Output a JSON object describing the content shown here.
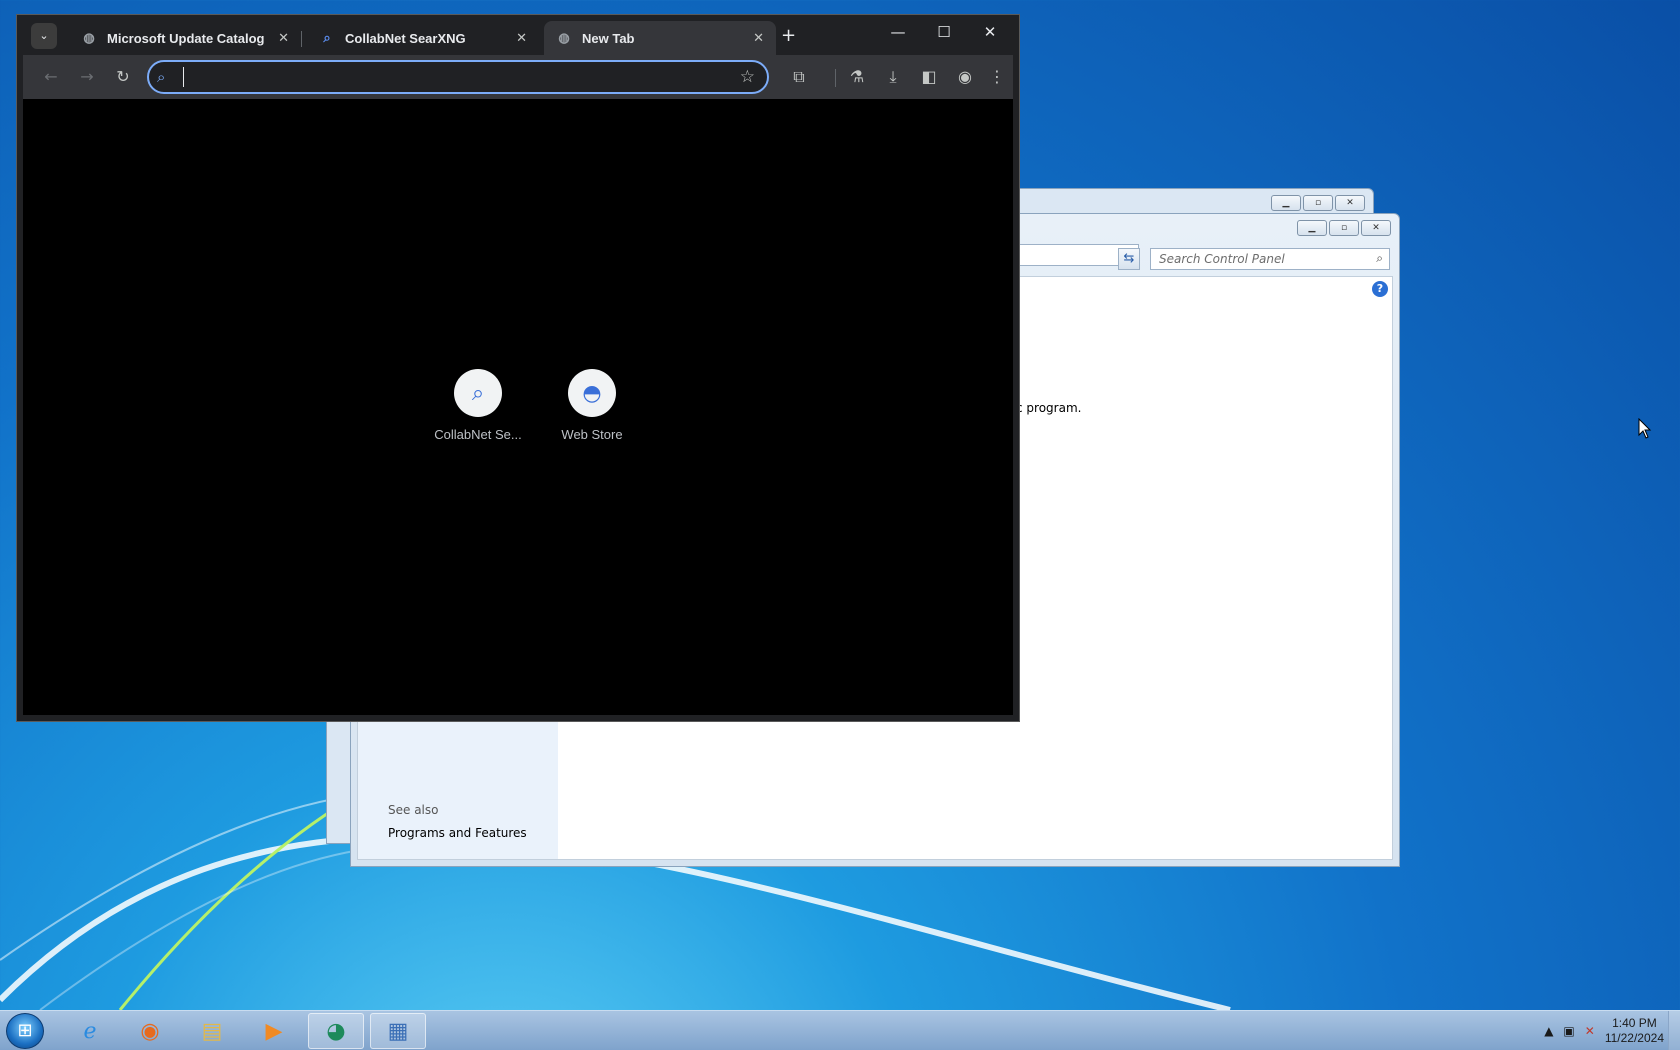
{
  "browser": {
    "tabs": [
      {
        "title": "Microsoft Update Catalog",
        "icon": "globe-icon",
        "active": false
      },
      {
        "title": "CollabNet SearXNG",
        "icon": "search-icon",
        "active": false
      },
      {
        "title": "New Tab",
        "icon": "globe-icon",
        "active": true
      }
    ],
    "omnibox": {
      "value": "",
      "placeholder": ""
    },
    "shortcuts": [
      {
        "label": "CollabNet Se...",
        "icon": "search-icon"
      },
      {
        "label": "Web Store",
        "icon": "web-store-icon"
      }
    ],
    "accent_color": "#7cacf8"
  },
  "control_panel": {
    "search_placeholder": "Search Control Panel",
    "content_fragment": "c program.",
    "see_also_heading": "See also",
    "programs_link": "Programs and Features"
  },
  "taskbar": {
    "clock_time": "1:40 PM",
    "clock_date": "11/22/2024",
    "apps": [
      "internet-explorer-icon",
      "firefox-icon",
      "file-explorer-icon",
      "media-player-icon",
      "chrome-icon",
      "control-panel-icon"
    ]
  }
}
